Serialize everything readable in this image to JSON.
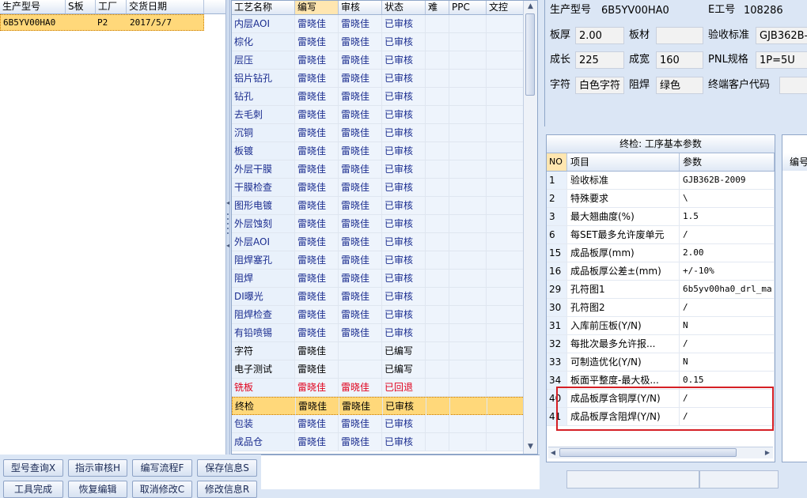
{
  "orders": {
    "columns": [
      "生产型号",
      "S板",
      "工厂",
      "交货日期"
    ],
    "rows": [
      {
        "model": "6B5YV00HA0",
        "s_board": "",
        "factory": "P2",
        "delivery": "2017/5/7"
      }
    ]
  },
  "process": {
    "columns": [
      "工艺名称",
      "编写",
      "审核",
      "状态",
      "难",
      "PPC",
      "文控"
    ],
    "rows": [
      {
        "name": "内层AOI",
        "writer": "雷晓佳",
        "reviewer": "雷晓佳",
        "status": "已审核",
        "kind": "audited"
      },
      {
        "name": "棕化",
        "writer": "雷晓佳",
        "reviewer": "雷晓佳",
        "status": "已审核",
        "kind": "audited"
      },
      {
        "name": "层压",
        "writer": "雷晓佳",
        "reviewer": "雷晓佳",
        "status": "已审核",
        "kind": "audited"
      },
      {
        "name": "铝片钻孔",
        "writer": "雷晓佳",
        "reviewer": "雷晓佳",
        "status": "已审核",
        "kind": "audited"
      },
      {
        "name": "钻孔",
        "writer": "雷晓佳",
        "reviewer": "雷晓佳",
        "status": "已审核",
        "kind": "audited"
      },
      {
        "name": "去毛刺",
        "writer": "雷晓佳",
        "reviewer": "雷晓佳",
        "status": "已审核",
        "kind": "audited"
      },
      {
        "name": "沉铜",
        "writer": "雷晓佳",
        "reviewer": "雷晓佳",
        "status": "已审核",
        "kind": "audited"
      },
      {
        "name": "板镀",
        "writer": "雷晓佳",
        "reviewer": "雷晓佳",
        "status": "已审核",
        "kind": "audited"
      },
      {
        "name": "外层干膜",
        "writer": "雷晓佳",
        "reviewer": "雷晓佳",
        "status": "已审核",
        "kind": "audited"
      },
      {
        "name": "干膜检查",
        "writer": "雷晓佳",
        "reviewer": "雷晓佳",
        "status": "已审核",
        "kind": "audited"
      },
      {
        "name": "图形电镀",
        "writer": "雷晓佳",
        "reviewer": "雷晓佳",
        "status": "已审核",
        "kind": "audited"
      },
      {
        "name": "外层蚀刻",
        "writer": "雷晓佳",
        "reviewer": "雷晓佳",
        "status": "已审核",
        "kind": "audited"
      },
      {
        "name": "外层AOI",
        "writer": "雷晓佳",
        "reviewer": "雷晓佳",
        "status": "已审核",
        "kind": "audited"
      },
      {
        "name": "阻焊塞孔",
        "writer": "雷晓佳",
        "reviewer": "雷晓佳",
        "status": "已审核",
        "kind": "audited"
      },
      {
        "name": "阻焊",
        "writer": "雷晓佳",
        "reviewer": "雷晓佳",
        "status": "已审核",
        "kind": "audited"
      },
      {
        "name": "DI曝光",
        "writer": "雷晓佳",
        "reviewer": "雷晓佳",
        "status": "已审核",
        "kind": "audited"
      },
      {
        "name": "阻焊检查",
        "writer": "雷晓佳",
        "reviewer": "雷晓佳",
        "status": "已审核",
        "kind": "audited"
      },
      {
        "name": "有铅喷锡",
        "writer": "雷晓佳",
        "reviewer": "雷晓佳",
        "status": "已审核",
        "kind": "audited"
      },
      {
        "name": "字符",
        "writer": "雷晓佳",
        "reviewer": "",
        "status": "已编写",
        "kind": "written"
      },
      {
        "name": "电子测试",
        "writer": "雷晓佳",
        "reviewer": "",
        "status": "已编写",
        "kind": "written"
      },
      {
        "name": "铣板",
        "writer": "雷晓佳",
        "reviewer": "雷晓佳",
        "status": "已回退",
        "kind": "returned"
      },
      {
        "name": "终检",
        "writer": "雷晓佳",
        "reviewer": "雷晓佳",
        "status": "已审核",
        "kind": "selected"
      },
      {
        "name": "包装",
        "writer": "雷晓佳",
        "reviewer": "雷晓佳",
        "status": "已审核",
        "kind": "audited"
      },
      {
        "name": "成品仓",
        "writer": "雷晓佳",
        "reviewer": "雷晓佳",
        "status": "已审核",
        "kind": "audited"
      }
    ]
  },
  "info": {
    "model_label": "生产型号",
    "model_value": "6B5YV00HA0",
    "eno_label": "E工号",
    "eno_value": "108286",
    "thickness_label": "板厚",
    "thickness_value": "2.00",
    "material_label": "板材",
    "material_value": "",
    "standard_label": "验收标准",
    "standard_value": "GJB362B-",
    "length_label": "成长",
    "length_value": "225",
    "width_label": "成宽",
    "width_value": "160",
    "pnl_label": "PNL规格",
    "pnl_value": "1P=5U",
    "char_label": "字符",
    "char_value": "白色字符",
    "mask_label": "阻焊",
    "mask_value": "绿色",
    "customer_label": "终端客户代码",
    "customer_value": ""
  },
  "params": {
    "title": "终检: 工序基本参数",
    "col_no": "NO",
    "col_item": "项目",
    "col_value": "参数",
    "rows": [
      {
        "no": "1",
        "item": "验收标准",
        "value": "GJB362B-2009"
      },
      {
        "no": "2",
        "item": "特殊要求",
        "value": "\\"
      },
      {
        "no": "3",
        "item": "最大翘曲度(%)",
        "value": "1.5"
      },
      {
        "no": "6",
        "item": "每SET最多允许废单元",
        "value": "/"
      },
      {
        "no": "15",
        "item": "成品板厚(mm)",
        "value": "2.00"
      },
      {
        "no": "16",
        "item": "成品板厚公差±(mm)",
        "value": "+/-10%"
      },
      {
        "no": "29",
        "item": "孔符图1",
        "value": "6b5yv00ha0_drl_ma"
      },
      {
        "no": "30",
        "item": "孔符图2",
        "value": "/"
      },
      {
        "no": "31",
        "item": "入库前压板(Y/N)",
        "value": "N"
      },
      {
        "no": "32",
        "item": "每批次最多允许报...",
        "value": "/"
      },
      {
        "no": "33",
        "item": "可制造优化(Y/N)",
        "value": "N"
      },
      {
        "no": "34",
        "item": "板面平整度-最大极...",
        "value": "0.15"
      },
      {
        "no": "40",
        "item": "成品板厚含铜厚(Y/N)",
        "value": "/"
      },
      {
        "no": "41",
        "item": "成品板厚含阻焊(Y/N)",
        "value": "/"
      }
    ]
  },
  "side": {
    "header": "编号"
  },
  "toolbar": {
    "b1": "型号查询X",
    "b2": "指示审核H",
    "b3": "编写流程F",
    "b4": "保存信息S",
    "b5": "工具完成",
    "b6": "恢复编辑",
    "b7": "取消修改C",
    "b8": "修改信息R"
  },
  "colors": {
    "audited_text": "#1a2c8f",
    "returned_text": "#e0001b",
    "selected_row": "#ffd87a",
    "highlight_box": "#d51f25"
  }
}
